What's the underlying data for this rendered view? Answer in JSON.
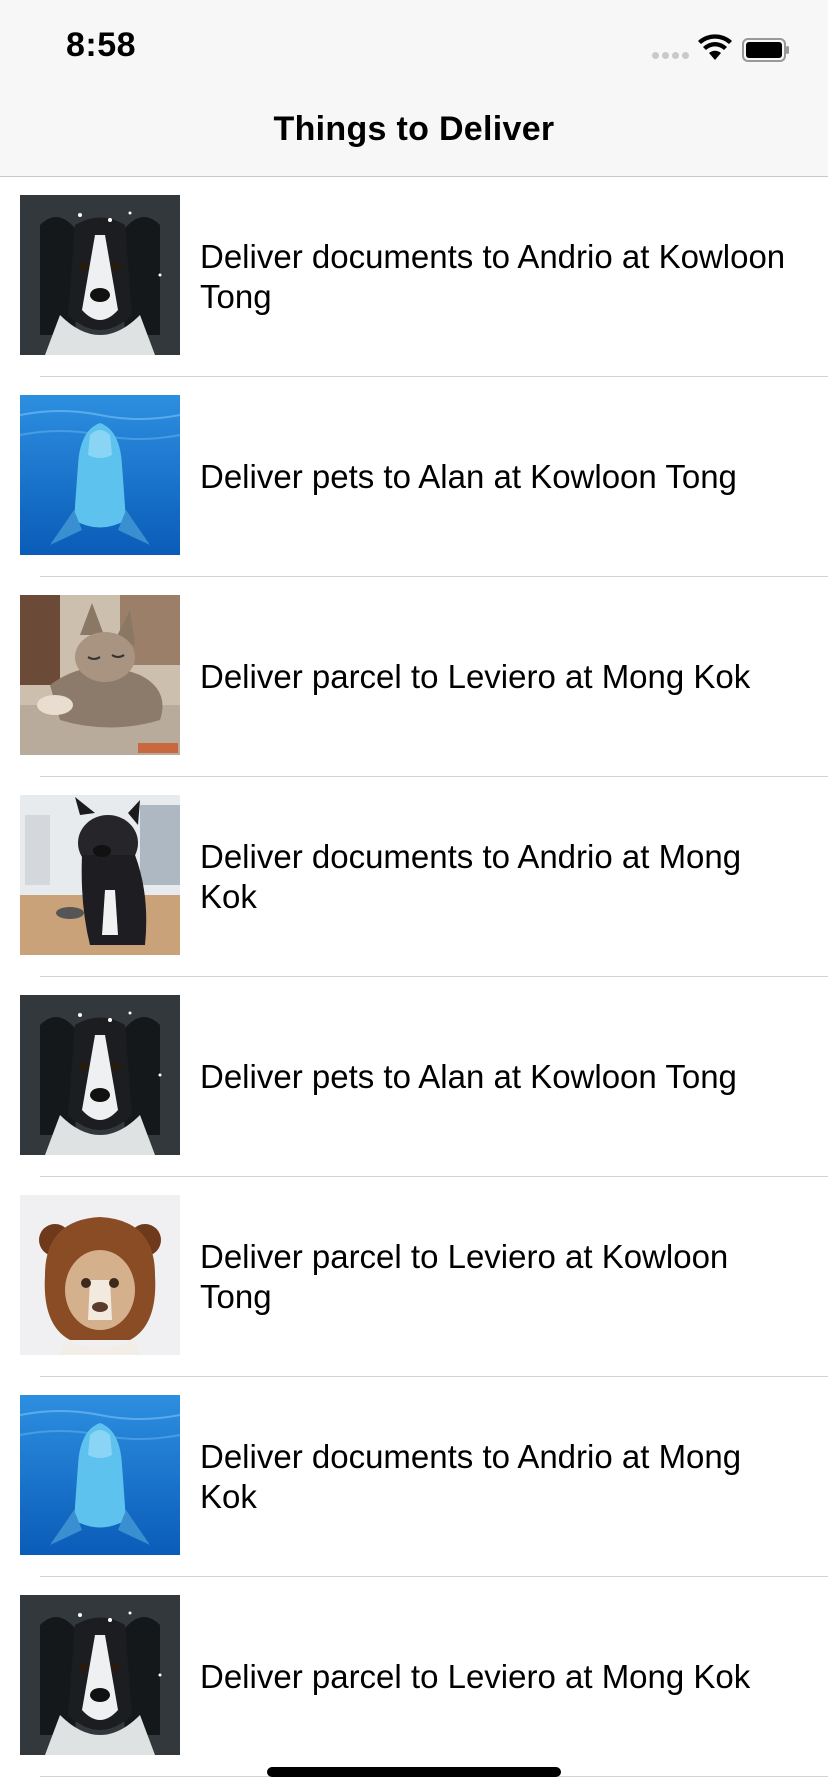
{
  "status_bar": {
    "time": "8:58"
  },
  "nav": {
    "title": "Things to Deliver"
  },
  "colors": {
    "nav_background": "#f7f7f7",
    "separator": "#d1d1d6",
    "text": "#000000"
  },
  "items": [
    {
      "label": "Deliver documents to Andrio at Kowloon Tong",
      "image": "border-collie-dog-photo"
    },
    {
      "label": "Deliver pets to Alan at Kowloon Tong",
      "image": "dolphin-underwater-photo"
    },
    {
      "label": "Deliver parcel to Leviero at Mong Kok",
      "image": "sleeping-cat-photo"
    },
    {
      "label": "Deliver documents to Andrio at Mong Kok",
      "image": "french-bulldog-photo"
    },
    {
      "label": "Deliver pets to Alan at Kowloon Tong",
      "image": "border-collie-dog-photo"
    },
    {
      "label": "Deliver parcel to Leviero at Kowloon Tong",
      "image": "dog-in-lion-hood-photo"
    },
    {
      "label": "Deliver documents to Andrio at Mong Kok",
      "image": "dolphin-underwater-photo"
    },
    {
      "label": "Deliver parcel to Leviero at Mong Kok",
      "image": "border-collie-dog-photo"
    }
  ]
}
